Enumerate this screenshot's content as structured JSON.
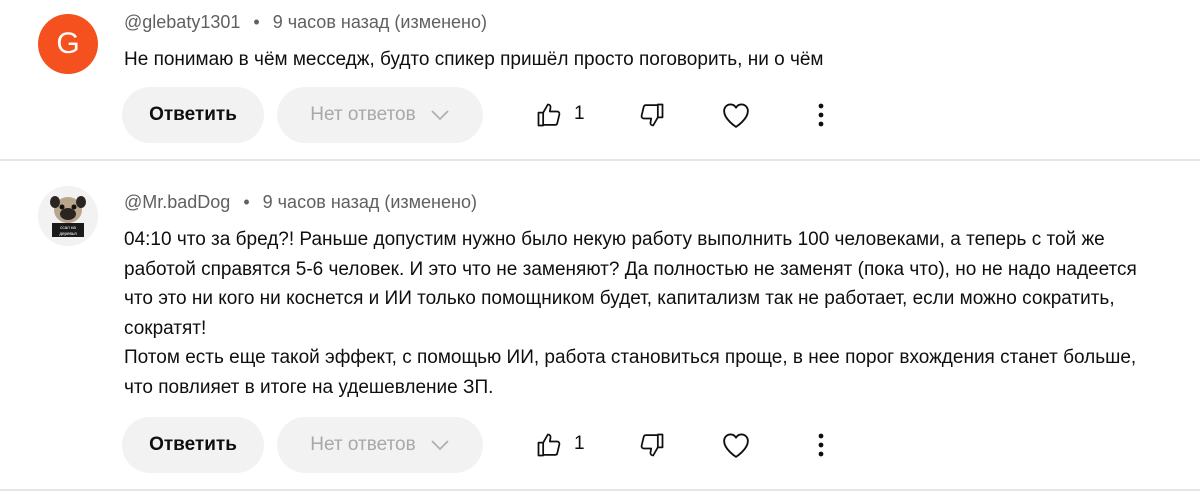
{
  "comments": [
    {
      "avatar_letter": "G",
      "author": "@glebaty1301",
      "separator": "•",
      "time": "9 часов назад (изменено)",
      "text": [
        "Не понимаю в чём месседж, будто спикер пришёл просто поговорить, ни о чём"
      ],
      "reply_label": "Ответить",
      "replies_label": "Нет ответов",
      "like_count": "1"
    },
    {
      "avatar_caption": "ссал на деревья",
      "author": "@Mr.badDog",
      "separator": "•",
      "time": "9 часов назад (изменено)",
      "text": [
        "04:10 что за бред?! Раньше допустим нужно было некую работу выполнить 100 человеками, а теперь с той же работой справятся 5-6 человек. И это что не заменяют? Да полностью не заменят (пока что), но не надо надеется что это ни кого ни коснется и ИИ только помощником будет, капитализм так не работает, если можно сократить, сократят!",
        "Потом есть еще такой эффект, с помощью ИИ, работа становиться проще, в нее порог вхождения станет больше, что повлияет в итоге на удешевление ЗП."
      ],
      "reply_label": "Ответить",
      "replies_label": "Нет ответов",
      "like_count": "1"
    }
  ],
  "colors": {
    "avatar_g": "#f4511e",
    "button_bg": "#f2f2f2",
    "meta": "#606060",
    "divider": "#e5e5e5"
  }
}
